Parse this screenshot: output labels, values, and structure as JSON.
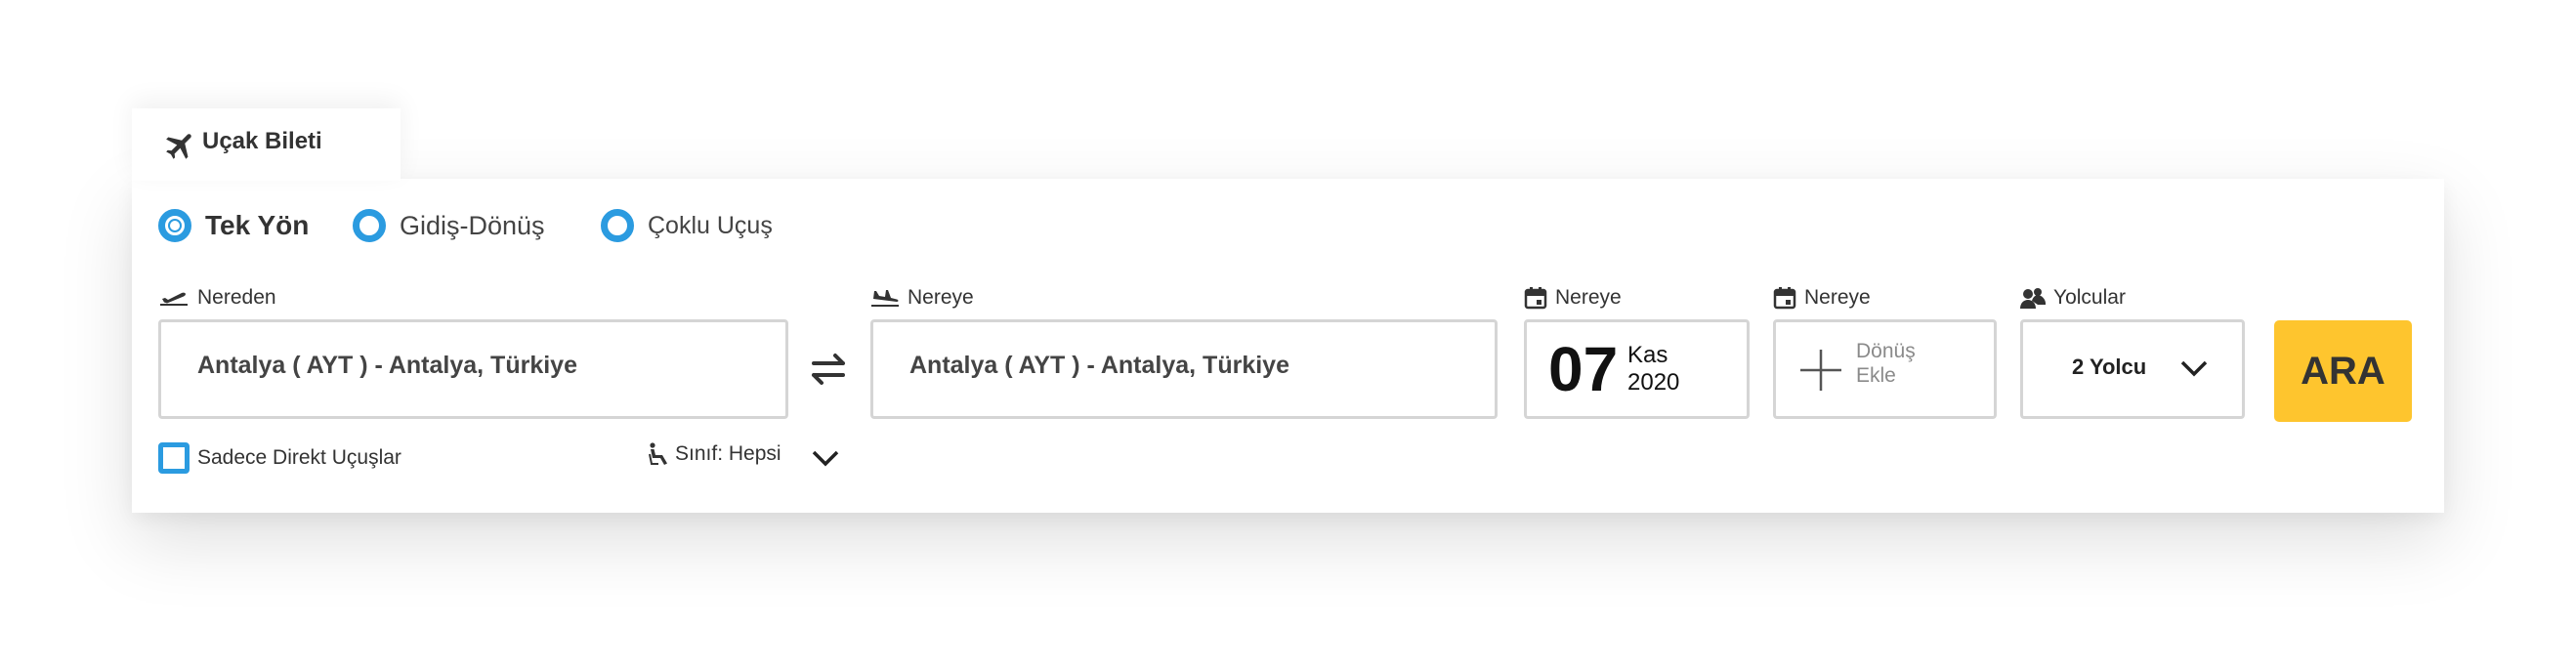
{
  "tab": {
    "label": "Uçak Bileti",
    "icon": "airplane-icon"
  },
  "trip_types": [
    {
      "label": "Tek Yön",
      "selected": true
    },
    {
      "label": "Gidiş-Dönüş",
      "selected": false
    },
    {
      "label": "Çoklu Uçuş",
      "selected": false
    }
  ],
  "from": {
    "label": "Nereden",
    "value": "Antalya ( AYT ) - Antalya, Türkiye",
    "icon": "takeoff-icon"
  },
  "to": {
    "label": "Nereye",
    "value": "Antalya ( AYT ) - Antalya, Türkiye",
    "icon": "landing-icon"
  },
  "depart": {
    "label": "Nereye",
    "day": "07",
    "month": "Kas",
    "year": "2020",
    "icon": "calendar-icon"
  },
  "return": {
    "label": "Nereye",
    "line1": "Dönüş",
    "line2": "Ekle",
    "icon": "calendar-icon"
  },
  "passengers": {
    "label": "Yolcular",
    "value": "2 Yolcu",
    "icon": "passengers-icon"
  },
  "search_button": "ARA",
  "direct_only": {
    "label": "Sadece Direkt Uçuşlar",
    "checked": false
  },
  "cabin_class": {
    "label": "Sınıf: Hepsi",
    "icon": "seat-icon"
  },
  "colors": {
    "accent_blue": "#2b9be0",
    "button_yellow": "#fec52e",
    "border": "#d5d5d5"
  }
}
